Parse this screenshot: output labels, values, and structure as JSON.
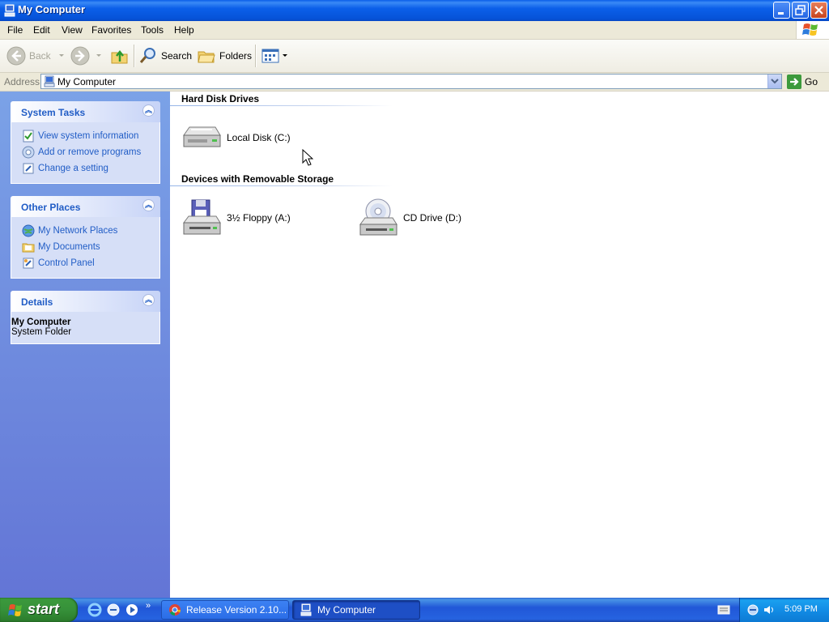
{
  "window": {
    "title": "My Computer",
    "buttons": [
      "minimize",
      "restore",
      "close"
    ]
  },
  "menu": {
    "items": [
      "File",
      "Edit",
      "View",
      "Favorites",
      "Tools",
      "Help"
    ]
  },
  "toolbar": {
    "back": "Back",
    "search": "Search",
    "folders": "Folders"
  },
  "address": {
    "label": "Address",
    "value": "My Computer",
    "go": "Go"
  },
  "taskpane": {
    "system_tasks": {
      "title": "System Tasks",
      "links": [
        "View system information",
        "Add or remove programs",
        "Change a setting"
      ]
    },
    "other_places": {
      "title": "Other Places",
      "links": [
        "My Network Places",
        "My Documents",
        "Control Panel"
      ]
    },
    "details": {
      "title": "Details",
      "name": "My Computer",
      "type": "System Folder"
    }
  },
  "content": {
    "groups": [
      {
        "heading": "Hard Disk Drives",
        "items": [
          {
            "label": "Local Disk (C:)",
            "icon": "hard-disk-icon"
          }
        ]
      },
      {
        "heading": "Devices with Removable Storage",
        "items": [
          {
            "label": "3½ Floppy (A:)",
            "icon": "floppy-drive-icon"
          },
          {
            "label": "CD Drive (D:)",
            "icon": "cd-drive-icon"
          }
        ]
      }
    ]
  },
  "taskbar": {
    "start": "start",
    "tasks": [
      {
        "label": "Release Version 2.10...",
        "icon": "chrome-icon",
        "active": false
      },
      {
        "label": "My Computer",
        "icon": "my-computer-icon",
        "active": true
      }
    ],
    "clock": "5:09 PM"
  },
  "colors": {
    "title_bar": "#0653d8",
    "task_pane": "#6375d6",
    "task_link": "#215dc6",
    "taskbar": "#2157d7",
    "start_button": "#36913a"
  }
}
